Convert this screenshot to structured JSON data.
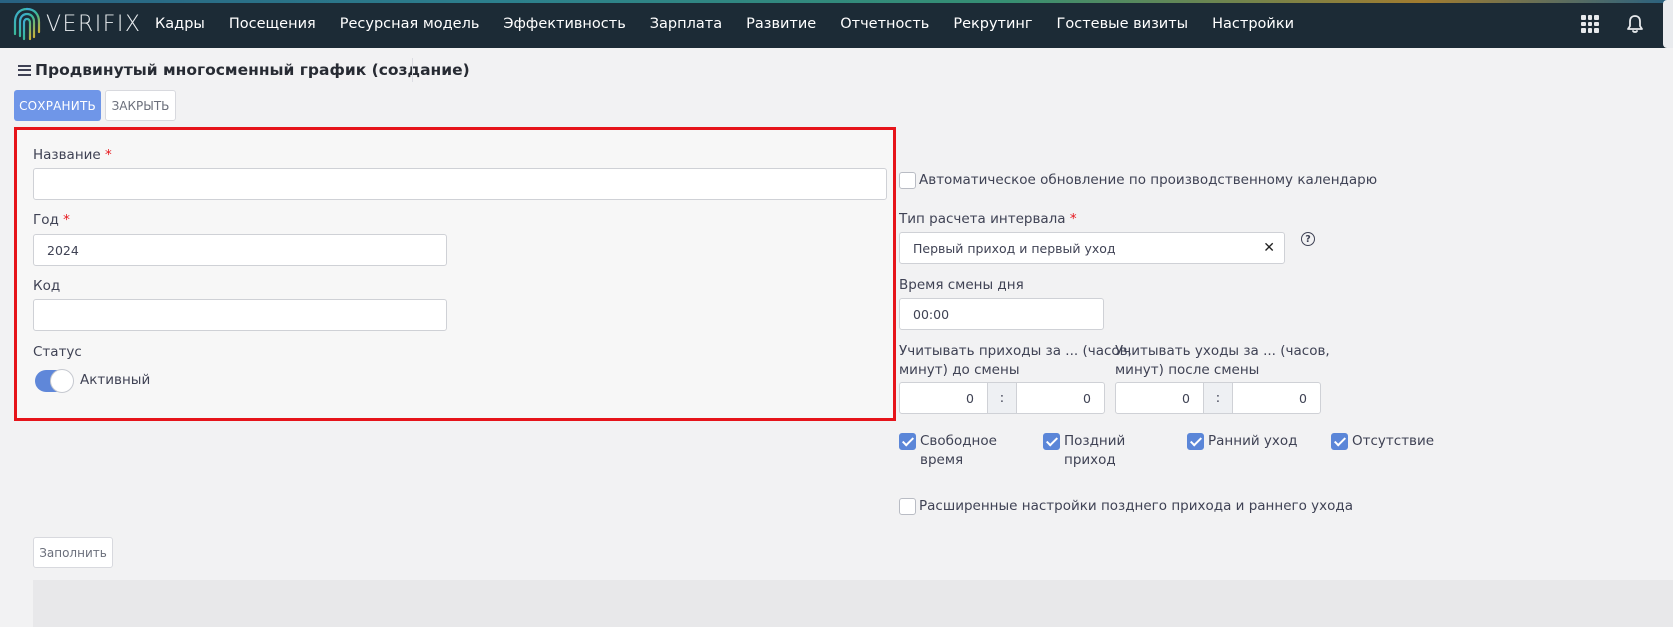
{
  "app": {
    "logo_text": "VERIFIX",
    "nav_items": [
      "Кадры",
      "Посещения",
      "Ресурсная модель",
      "Эффективность",
      "Зарплата",
      "Развитие",
      "Отчетность",
      "Рекрутинг",
      "Гостевые визиты",
      "Настройки"
    ],
    "icons": {
      "apps": "apps-grid-icon",
      "notifications": "bell-icon",
      "menu": "hamburger-icon"
    },
    "colors": {
      "navbar": "#1c2b36",
      "primary": "#6f96e8",
      "highlight_border": "#e6141a",
      "checkbox_checked": "#5b86d8"
    }
  },
  "page": {
    "title": "Продвинутый многосменный график (создание)",
    "save_label": "СОХРАНИТЬ",
    "close_label": "ЗАКРЫТЬ",
    "fill_label": "Заполнить"
  },
  "form": {
    "required_mark": "*",
    "name_label": "Название",
    "name_value": "",
    "year_label": "Год",
    "year_value": "2024",
    "code_label": "Код",
    "code_value": "",
    "status_label": "Статус",
    "status_value": "Активный",
    "status_on": true
  },
  "settings": {
    "auto_update_label": "Автоматическое обновление по производственному календарю",
    "auto_update_checked": false,
    "interval_type_label": "Тип расчета интервала",
    "interval_type_value": "Первый приход и первый уход",
    "clear_symbol": "✕",
    "help_symbol": "?",
    "day_change_label": "Время смены дня",
    "day_change_value": "00:00",
    "arrivals_label_1": "Учитывать приходы за ... (часов,",
    "arrivals_label_2": "минут) до смены",
    "arrivals_hours": "0",
    "arrivals_minutes": "0",
    "departures_label_1": "Учитывать уходы за ... (часов,",
    "departures_label_2": "минут) после смены",
    "departures_hours": "0",
    "departures_minutes": "0",
    "separator": ":",
    "checks": [
      {
        "line1": "Свободное",
        "line2": "время",
        "checked": true
      },
      {
        "line1": "Поздний",
        "line2": "приход",
        "checked": true
      },
      {
        "line1": "Ранний уход",
        "line2": "",
        "checked": true
      },
      {
        "line1": "Отсутствие",
        "line2": "",
        "checked": true
      }
    ],
    "advanced_label": "Расширенные настройки позднего прихода и раннего ухода",
    "advanced_checked": false
  }
}
